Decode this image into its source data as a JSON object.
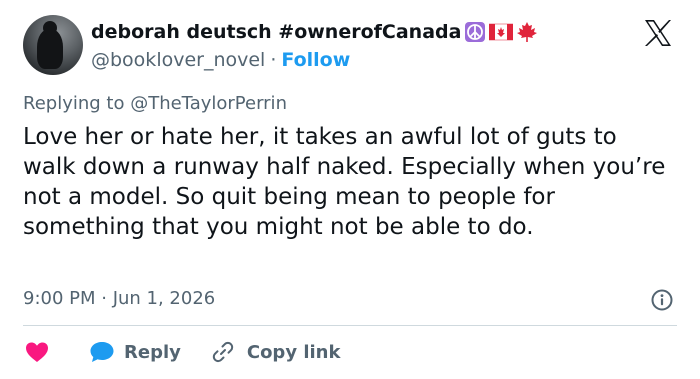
{
  "author": {
    "display_name": "deborah deutsch #ownerofCanada",
    "name_emojis": [
      "peace-symbol-icon",
      "canada-flag-icon",
      "maple-leaf-icon"
    ],
    "handle": "@booklover_novel",
    "separator": "·",
    "follow_label": "Follow"
  },
  "platform_logo": "x-logo-icon",
  "reply_context": {
    "text": "Replying to @TheTaylorPerrin"
  },
  "tweet": {
    "text": "Love her or hate her, it takes an awful lot of guts to walk down a runway half naked. Especially when you’re not a model. So quit being mean to people for something that you might not be able to do.",
    "timestamp": "9:00 PM · Jun 1, 2026"
  },
  "actions": {
    "like_icon": "heart-icon",
    "reply_label": "Reply",
    "copy_link_label": "Copy link"
  },
  "colors": {
    "text": "#0f1419",
    "secondary": "#536471",
    "link_blue": "#1d9bf0",
    "heart": "#f91880",
    "divider": "#cfd9de",
    "peace_purple": "#9b6cd9",
    "flag_red": "#e0243b"
  }
}
